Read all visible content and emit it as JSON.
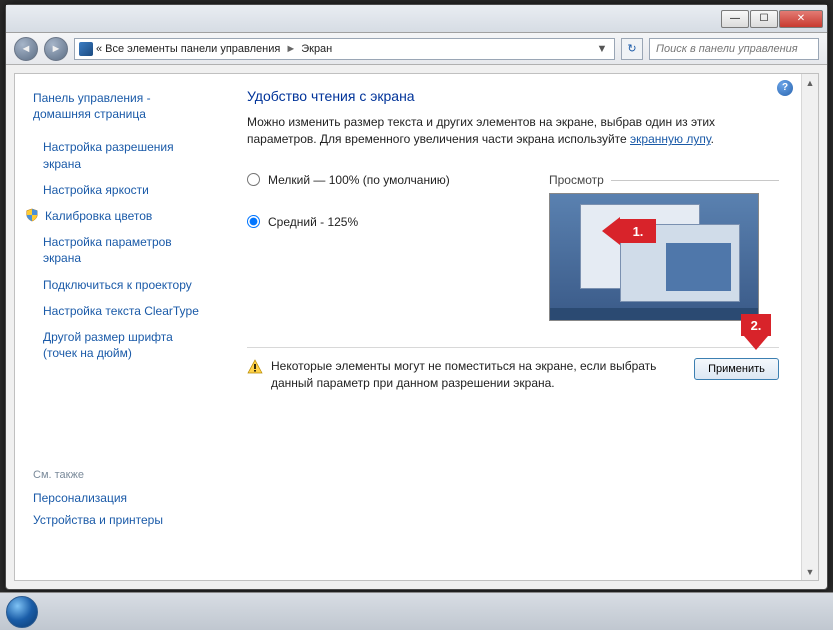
{
  "titlebar": {
    "minimize": "—",
    "maximize": "☐",
    "close": "✕"
  },
  "nav": {
    "back": "◄",
    "forward": "►",
    "breadcrumb_prefix": "«",
    "breadcrumb1": "Все элементы панели управления",
    "breadcrumb2": "Экран",
    "sep": "►",
    "dropdown": "▼",
    "refresh": "↻",
    "search_placeholder": "Поиск в панели управления"
  },
  "sidebar": {
    "home": "Панель управления - домашняя страница",
    "links": [
      "Настройка разрешения экрана",
      "Настройка яркости",
      "Калибровка цветов",
      "Настройка параметров экрана",
      "Подключиться к проектору",
      "Настройка текста ClearType",
      "Другой размер шрифта (точек на дюйм)"
    ],
    "see_also_title": "См. также",
    "see_also": [
      "Персонализация",
      "Устройства и принтеры"
    ]
  },
  "main": {
    "help": "?",
    "title": "Удобство чтения с экрана",
    "desc_pre": "Можно изменить размер текста и других элементов на экране, выбрав один из этих параметров. Для временного увеличения части экрана используйте ",
    "desc_link": "экранную лупу",
    "desc_post": ".",
    "radio1": "Мелкий — 100% (по умолчанию)",
    "radio2": "Средний - 125%",
    "preview_label": "Просмотр",
    "warning": "Некоторые элементы могут не поместиться на экране, если выбрать данный параметр при данном разрешении экрана.",
    "apply": "Применить"
  },
  "annotations": {
    "a1": "1.",
    "a2": "2."
  }
}
